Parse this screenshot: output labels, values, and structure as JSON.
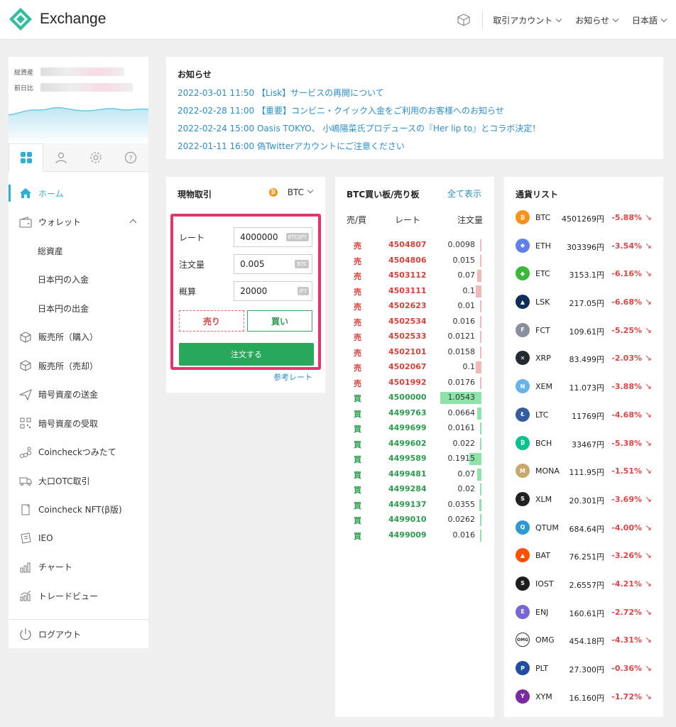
{
  "header": {
    "app_title": "Exchange",
    "nav": [
      {
        "label": "取引アカウント"
      },
      {
        "label": "お知らせ"
      },
      {
        "label": "日本語"
      }
    ],
    "brand_color": "#2fbf9f"
  },
  "sidebar": {
    "assets_label": "総資産",
    "prev_day_label": "前日比",
    "menu": [
      {
        "label": "ホーム",
        "icon": "home-icon",
        "active": true
      },
      {
        "label": "ウォレット",
        "icon": "wallet-icon",
        "expanded": true
      },
      {
        "label": "総資産",
        "sub": true
      },
      {
        "label": "日本円の入金",
        "sub": true
      },
      {
        "label": "日本円の出金",
        "sub": true
      },
      {
        "label": "販売所（購入）",
        "icon": "box-icon"
      },
      {
        "label": "販売所（売却）",
        "icon": "box-icon"
      },
      {
        "label": "暗号資産の送金",
        "icon": "send-icon"
      },
      {
        "label": "暗号資産の受取",
        "icon": "qr-icon"
      },
      {
        "label": "Coincheckつみたて",
        "icon": "coins-icon"
      },
      {
        "label": "大口OTC取引",
        "icon": "truck-icon"
      },
      {
        "label": "Coincheck NFT(β版)",
        "icon": "nft-icon"
      },
      {
        "label": "IEO",
        "icon": "ticket-icon"
      },
      {
        "label": "チャート",
        "icon": "chart-icon"
      },
      {
        "label": "トレードビュー",
        "icon": "tradeview-icon"
      }
    ],
    "logout_label": "ログアウト"
  },
  "news": {
    "title": "お知らせ",
    "items": [
      "2022-03-01 11:50 【Lisk】サービスの再開について",
      "2022-02-28 11:00 【重要】コンビニ・クイック入金をご利用のお客様へのお知らせ",
      "2022-02-24 15:00 Oasis TOKYO、 小嶋陽菜氏プロデュースの『Her lip to』とコラボ決定！",
      "2022-01-11 16:00 偽Twitterアカウントにご注意ください"
    ]
  },
  "spot": {
    "title": "現物取引",
    "coin": "BTC",
    "rate_label": "レート",
    "rate_value": "4000000",
    "rate_unit": "BTC/JPY",
    "amount_label": "注文量",
    "amount_value": "0.005",
    "amount_unit": "BTC",
    "estimate_label": "概算",
    "estimate_value": "20000",
    "estimate_unit": "JPY",
    "sell_label": "売り",
    "buy_label": "買い",
    "order_label": "注文する",
    "ref_rate_label": "参考レート"
  },
  "orderbook": {
    "title": "BTC買い板/売り板",
    "show_all": "全て表示",
    "col_side": "売/買",
    "col_rate": "レート",
    "col_qty": "注文量",
    "rows": [
      {
        "side": "売",
        "type": "s",
        "rate": "4504807",
        "qty": "0.0098",
        "depth": 0.04
      },
      {
        "side": "売",
        "type": "s",
        "rate": "4504806",
        "qty": "0.015",
        "depth": 0.04
      },
      {
        "side": "売",
        "type": "s",
        "rate": "4503112",
        "qty": "0.07",
        "depth": 0.1
      },
      {
        "side": "売",
        "type": "s",
        "rate": "4503111",
        "qty": "0.1",
        "depth": 0.14
      },
      {
        "side": "売",
        "type": "s",
        "rate": "4502623",
        "qty": "0.01",
        "depth": 0.04
      },
      {
        "side": "売",
        "type": "s",
        "rate": "4502534",
        "qty": "0.016",
        "depth": 0.04
      },
      {
        "side": "売",
        "type": "s",
        "rate": "4502533",
        "qty": "0.0121",
        "depth": 0.04
      },
      {
        "side": "売",
        "type": "s",
        "rate": "4502101",
        "qty": "0.0158",
        "depth": 0.04
      },
      {
        "side": "売",
        "type": "s",
        "rate": "4502067",
        "qty": "0.1",
        "depth": 0.14
      },
      {
        "side": "売",
        "type": "s",
        "rate": "4501992",
        "qty": "0.0176",
        "depth": 0.04
      },
      {
        "side": "買",
        "type": "b",
        "rate": "4500000",
        "qty": "1.0543",
        "depth": 1.0
      },
      {
        "side": "買",
        "type": "b",
        "rate": "4499763",
        "qty": "0.0664",
        "depth": 0.1
      },
      {
        "side": "買",
        "type": "b",
        "rate": "4499699",
        "qty": "0.0161",
        "depth": 0.04
      },
      {
        "side": "買",
        "type": "b",
        "rate": "4499602",
        "qty": "0.022",
        "depth": 0.04
      },
      {
        "side": "買",
        "type": "b",
        "rate": "4499589",
        "qty": "0.1915",
        "depth": 0.3
      },
      {
        "side": "買",
        "type": "b",
        "rate": "4499481",
        "qty": "0.07",
        "depth": 0.1
      },
      {
        "side": "買",
        "type": "b",
        "rate": "4499284",
        "qty": "0.02",
        "depth": 0.04
      },
      {
        "side": "買",
        "type": "b",
        "rate": "4499137",
        "qty": "0.0355",
        "depth": 0.06
      },
      {
        "side": "買",
        "type": "b",
        "rate": "4499010",
        "qty": "0.0262",
        "depth": 0.04
      },
      {
        "side": "買",
        "type": "b",
        "rate": "4499009",
        "qty": "0.016",
        "depth": 0.04
      }
    ]
  },
  "coinlist": {
    "title": "通貨リスト",
    "coins": [
      {
        "sym": "BTC",
        "price": "4501269円",
        "change": "-5.88%",
        "color": "#f7931a",
        "glyph": "₿"
      },
      {
        "sym": "ETH",
        "price": "303396円",
        "change": "-3.54%",
        "color": "#627eea",
        "glyph": "◆"
      },
      {
        "sym": "ETC",
        "price": "3153.1円",
        "change": "-6.16%",
        "color": "#3ab83a",
        "glyph": "◆"
      },
      {
        "sym": "LSK",
        "price": "217.05円",
        "change": "-6.68%",
        "color": "#0d2f5a",
        "glyph": "▲"
      },
      {
        "sym": "FCT",
        "price": "109.61円",
        "change": "-5.25%",
        "color": "#8a8fa0",
        "glyph": "F"
      },
      {
        "sym": "XRP",
        "price": "83.499円",
        "change": "-2.03%",
        "color": "#23292f",
        "glyph": "✕"
      },
      {
        "sym": "XEM",
        "price": "11.073円",
        "change": "-3.88%",
        "color": "#67b2e8",
        "glyph": "N"
      },
      {
        "sym": "LTC",
        "price": "11769円",
        "change": "-4.68%",
        "color": "#345d9d",
        "glyph": "Ł"
      },
      {
        "sym": "BCH",
        "price": "33467円",
        "change": "-5.38%",
        "color": "#0ac18e",
        "glyph": "₿"
      },
      {
        "sym": "MONA",
        "price": "111.95円",
        "change": "-1.51%",
        "color": "#c8a86b",
        "glyph": "M"
      },
      {
        "sym": "XLM",
        "price": "20.301円",
        "change": "-3.69%",
        "color": "#222222",
        "glyph": "S"
      },
      {
        "sym": "QTUM",
        "price": "684.64円",
        "change": "-4.00%",
        "color": "#2e9ad0",
        "glyph": "Q"
      },
      {
        "sym": "BAT",
        "price": "76.251円",
        "change": "-3.26%",
        "color": "#ff5000",
        "glyph": "▲"
      },
      {
        "sym": "IOST",
        "price": "2.6557円",
        "change": "-4.21%",
        "color": "#1c1c1c",
        "glyph": "S"
      },
      {
        "sym": "ENJ",
        "price": "160.61円",
        "change": "-2.72%",
        "color": "#7866d5",
        "glyph": "E"
      },
      {
        "sym": "OMG",
        "price": "454.18円",
        "change": "-4.31%",
        "color": "#ffffff",
        "glyph": "OMG"
      },
      {
        "sym": "PLT",
        "price": "27.300円",
        "change": "-0.36%",
        "color": "#1f4ea0",
        "glyph": "P"
      },
      {
        "sym": "XYM",
        "price": "16.160円",
        "change": "-1.72%",
        "color": "#7b2aa0",
        "glyph": "Y"
      }
    ],
    "change_color": "#e04545"
  }
}
